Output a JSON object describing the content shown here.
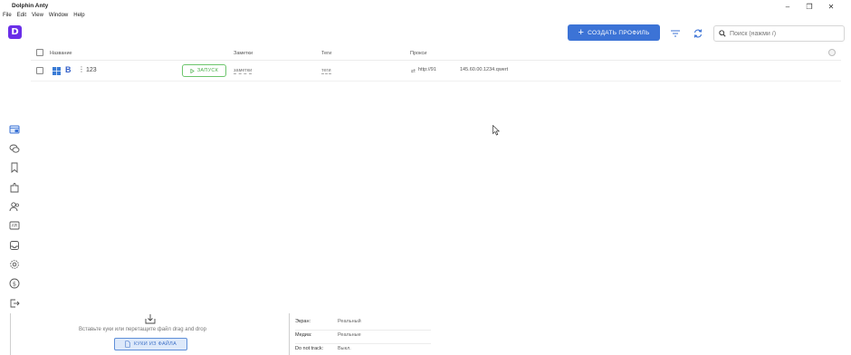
{
  "window": {
    "title": "Dolphin Anty",
    "minimize": "–",
    "restore": "❐",
    "close": "✕"
  },
  "menu": [
    "File",
    "Edit",
    "View",
    "Window",
    "Help"
  ],
  "logo": {
    "letter": "D",
    "color": "#6a2ee8"
  },
  "toolbar": {
    "create_label": "СОЗДАТЬ ПРОФИЛЬ",
    "create_icon": "+",
    "search_placeholder": "Поиск (нажми /)",
    "accent": "#3c73d6"
  },
  "sidebar": {
    "items": [
      {
        "icon": "browser-profiles-icon",
        "active": true
      },
      {
        "icon": "chat-icon"
      },
      {
        "icon": "bookmark-icon"
      },
      {
        "icon": "extensions-icon"
      },
      {
        "icon": "users-icon"
      },
      {
        "icon": "api-icon"
      },
      {
        "icon": "inbox-icon"
      },
      {
        "icon": "settings-icon"
      },
      {
        "icon": "billing-icon"
      },
      {
        "icon": "logout-icon"
      }
    ]
  },
  "table": {
    "columns": [
      "Название",
      "Заметки",
      "Теги",
      "Прокси"
    ],
    "rows": [
      {
        "os": "windows-icon",
        "browser": "B",
        "name": "123",
        "start_label": "ЗАПУСК",
        "notes": "заметки",
        "tags": "теги",
        "proxy_type": "http://91",
        "proxy_host": "145.60.00.1234.qwert",
        "start_color": "#4ab04a"
      }
    ]
  },
  "cookies": {
    "drop_text": "Вставьте куки или перетащите файл drag and drop",
    "button_label": "КУКИ ИЗ ФАЙЛА"
  },
  "properties": [
    {
      "key": "Экран:",
      "value": "Реальный"
    },
    {
      "key": "Медиа:",
      "value": "Реальные"
    },
    {
      "key": "Do not track:",
      "value": "Выкл."
    }
  ]
}
